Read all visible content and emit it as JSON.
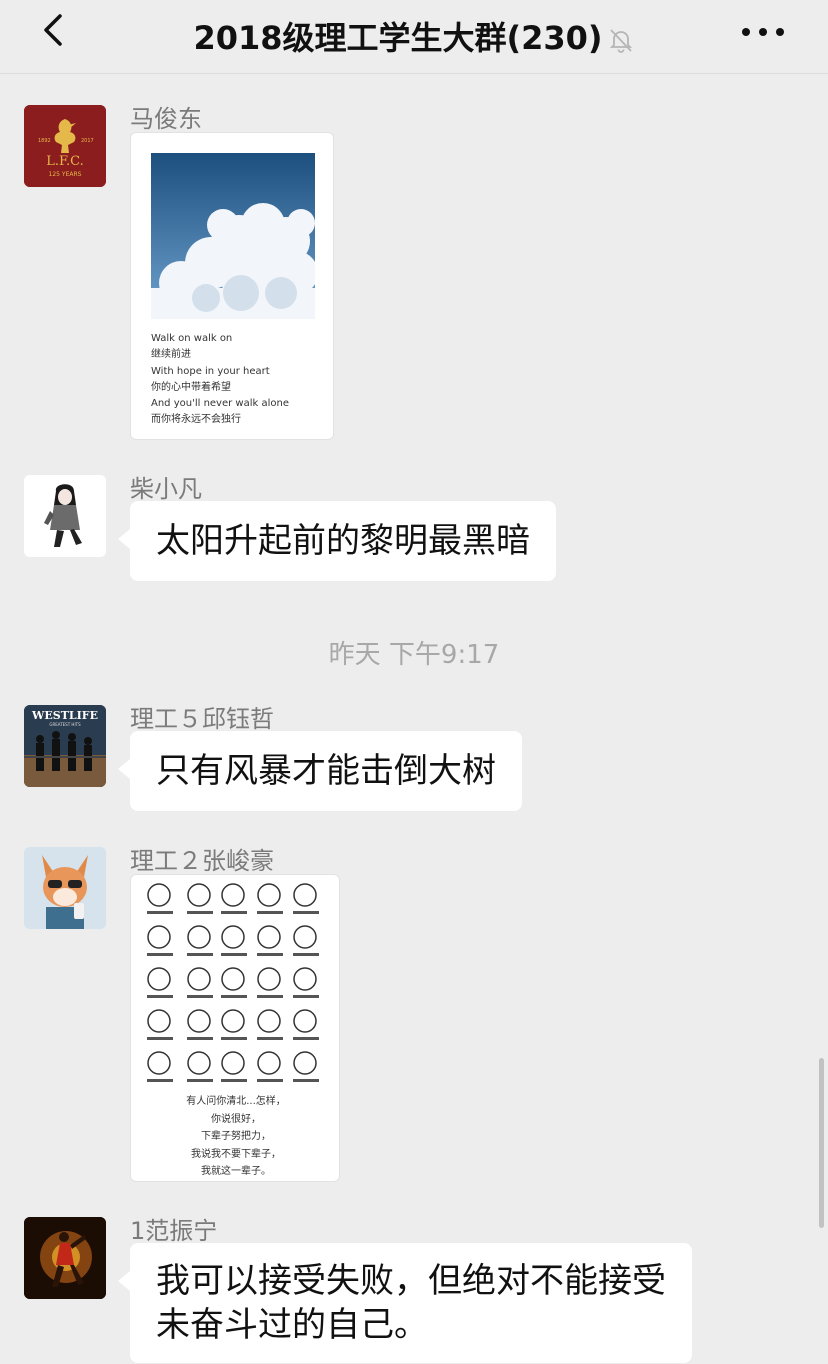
{
  "header": {
    "title": "2018级理工学生大群(230)",
    "icons": {
      "back": "chevron-left-icon",
      "mute": "bell-muted-icon",
      "more": "more-horizontal-icon"
    }
  },
  "messages": [
    {
      "sender": "马俊东",
      "type": "image",
      "avatar_text": "L.F.C.",
      "avatar_sub": "125 YEARS",
      "avatar_years_left": "1892",
      "avatar_years_right": "2017",
      "image_lines": [
        "Walk on  walk on",
        "继续前进",
        "With hope  in your heart",
        "你的心中带着希望",
        "And you'll never walk alone",
        "而你将永远不会独行"
      ]
    },
    {
      "sender": "柴小凡",
      "type": "text",
      "text": "太阳升起前的黎明最黑暗"
    },
    {
      "sender": "理工５邱钰哲",
      "type": "text",
      "text": "只有风暴才能击倒大树",
      "avatar_text": "WESTLIFE",
      "avatar_sub": "GREATEST HITS"
    },
    {
      "sender": "理工２张峻豪",
      "type": "image",
      "image_lines": [
        "有人问你清北...怎样，",
        "你说很好，",
        "下辈子努把力，",
        "我说我不要下辈子，",
        "我就这一辈子。"
      ]
    },
    {
      "sender": "1范振宁",
      "type": "text",
      "text_line1": "我可以接受失败，但绝对不能接受",
      "text_line2": "未奋斗过的自己。"
    }
  ],
  "timestamp": "昨天 下午9:17",
  "colors": {
    "background": "#ededed",
    "bubble": "#ffffff",
    "name": "#7b7b7b",
    "timestamp": "#a8a8a8"
  }
}
